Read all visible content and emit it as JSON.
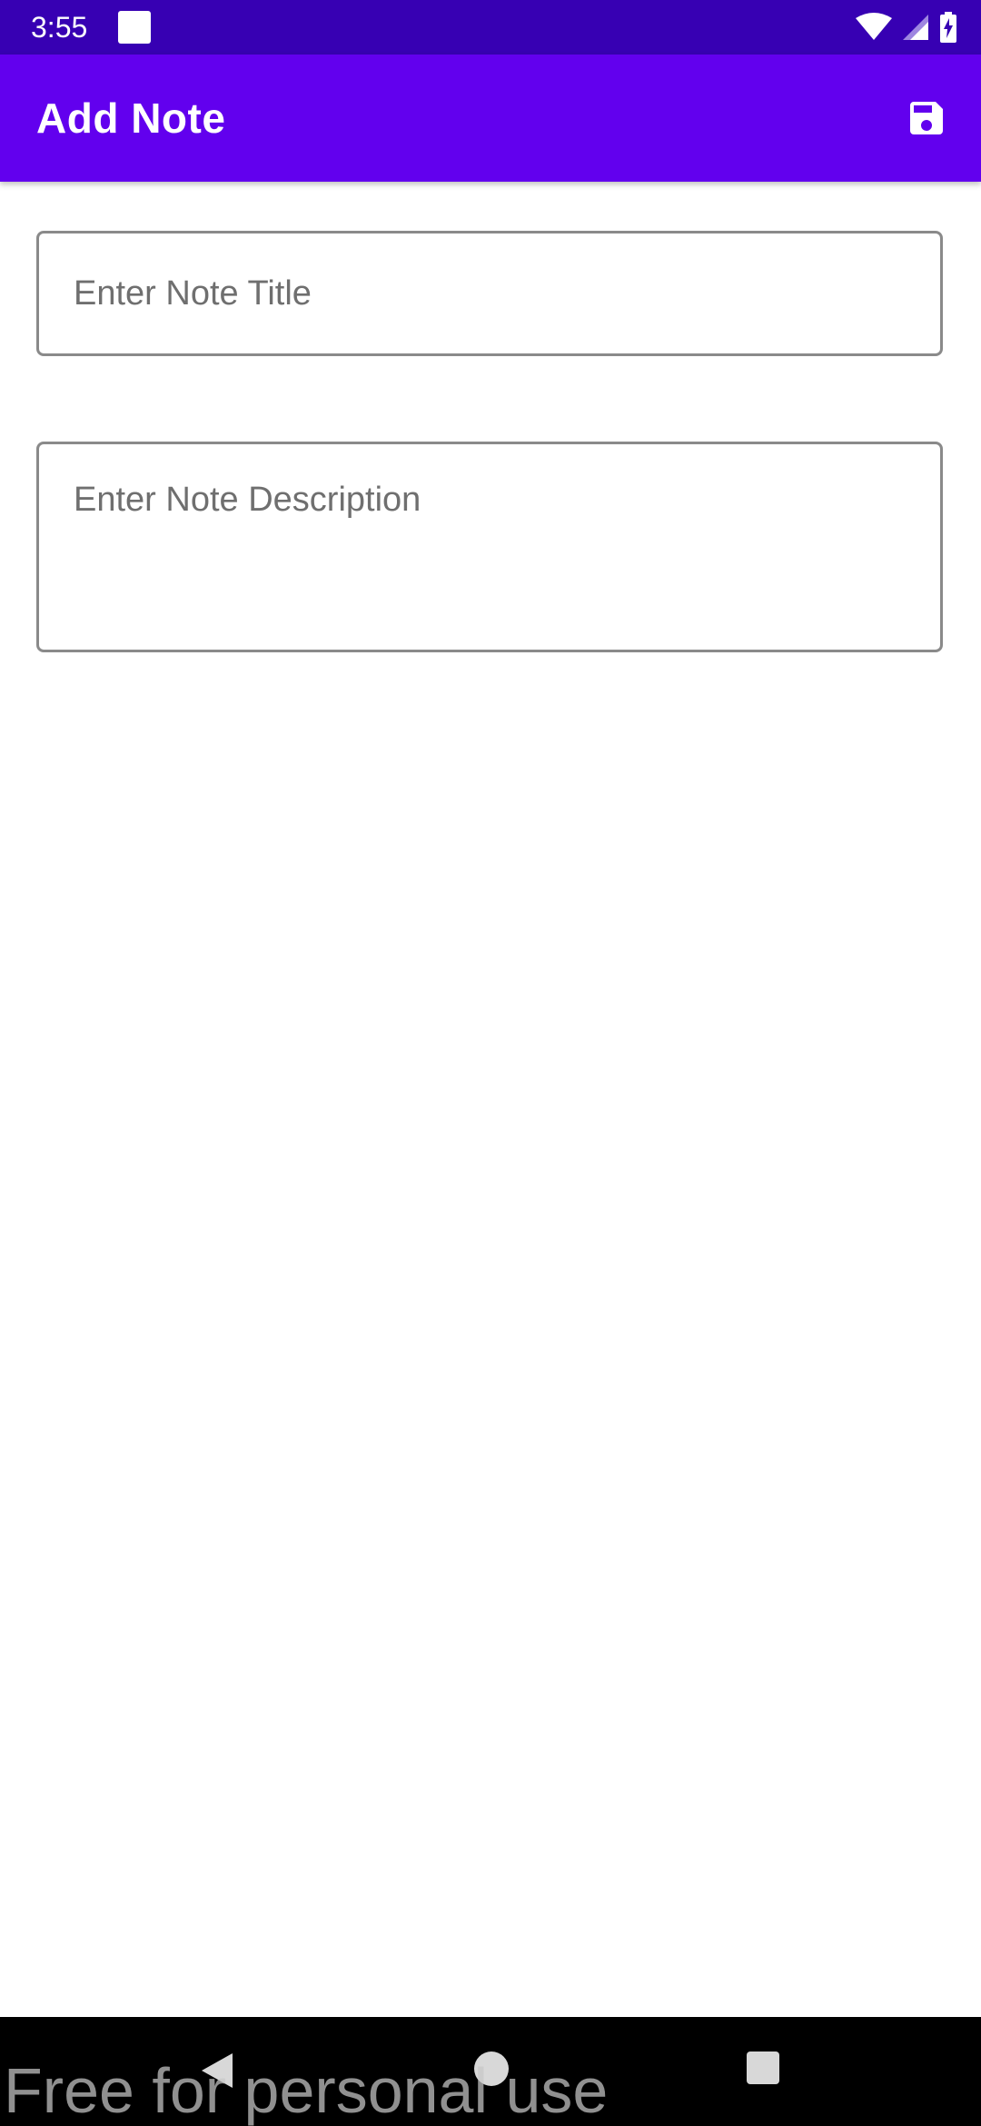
{
  "status_bar": {
    "time": "3:55",
    "icons": [
      "notification-square-icon",
      "wifi-icon",
      "signal-icon",
      "battery-charging-icon"
    ]
  },
  "app_bar": {
    "title": "Add Note",
    "save_icon": "save-icon",
    "background_color": "#6200ee",
    "status_color": "#3700b3"
  },
  "form": {
    "title_field": {
      "placeholder": "Enter Note Title",
      "value": ""
    },
    "description_field": {
      "placeholder": "Enter Note Description",
      "value": ""
    }
  },
  "nav_bar": {
    "buttons": [
      "back-icon",
      "home-icon",
      "recents-icon"
    ]
  },
  "watermark": {
    "text": "Free for personal use"
  }
}
